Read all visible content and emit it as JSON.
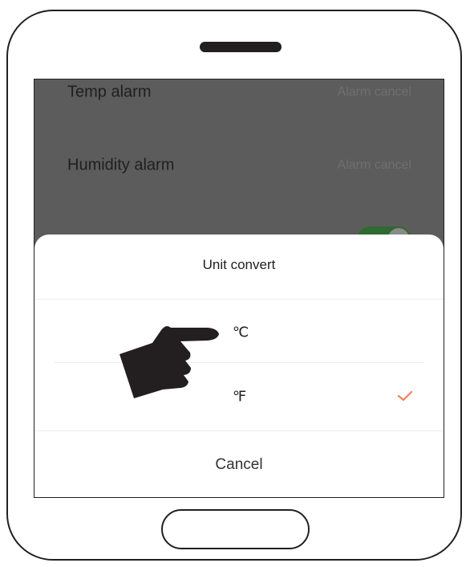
{
  "settings": {
    "temp_alarm": {
      "label": "Temp alarm",
      "value": "Alarm cancel"
    },
    "humidity_alarm": {
      "label": "Humidity alarm",
      "value": "Alarm cancel"
    },
    "third_row": {
      "toggle_on": true,
      "toggle_color": "#2f6a31"
    }
  },
  "sheet": {
    "title": "Unit convert",
    "options": [
      {
        "label": "℃",
        "selected": false
      },
      {
        "label": "℉",
        "selected": true
      }
    ],
    "check_color": "#f2825a",
    "cancel_label": "Cancel"
  },
  "overlay": {
    "pointer_icon": "pointing-hand-icon"
  }
}
